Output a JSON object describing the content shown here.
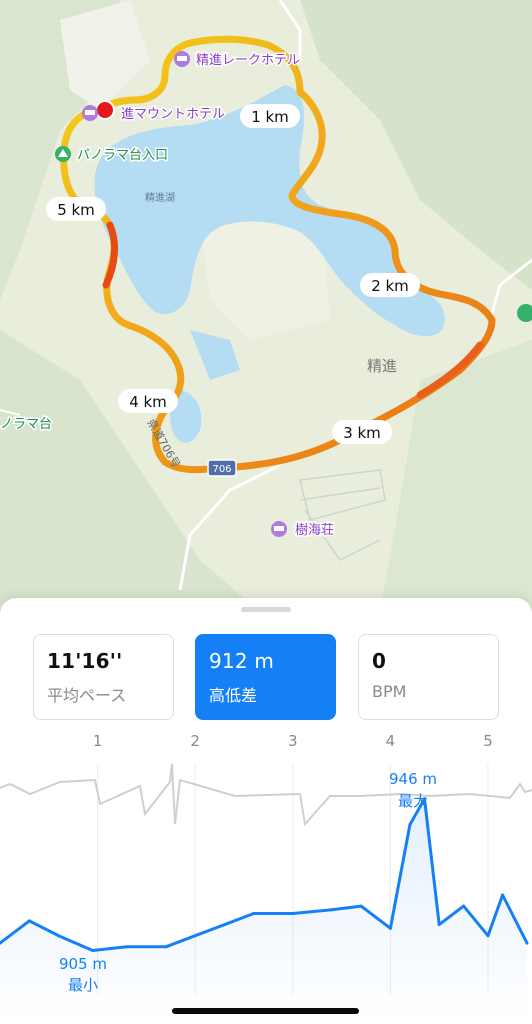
{
  "map": {
    "lake_name": "精進湖",
    "area_name": "精進",
    "road_name": "県道706号",
    "route_badge": "706",
    "pois": [
      {
        "label": "精進レークホテル",
        "icon": "hotel-icon"
      },
      {
        "label": "進マウントホテル",
        "icon": "hotel-icon"
      },
      {
        "label": "パノラマ台入口",
        "icon": "trailhead-icon"
      },
      {
        "label": "ノラマ台",
        "icon": "peak-icon"
      },
      {
        "label": "樹海荘",
        "icon": "hotel-icon"
      }
    ],
    "km_markers": [
      "1 km",
      "2 km",
      "3 km",
      "4 km",
      "5 km"
    ],
    "colors": {
      "land": "#e9efdc",
      "lake": "#b4dcf3",
      "route_slow": "#f3c512",
      "route_fast": "#e64b14",
      "start_marker": "#e5161c"
    }
  },
  "stats": {
    "pace": {
      "value": "11'16''",
      "label": "平均ペース"
    },
    "elevation": {
      "value": "912 m",
      "label": "高低差"
    },
    "heart_rate": {
      "value": "0",
      "label": "BPM"
    }
  },
  "chart_data": {
    "type": "line",
    "x_ticks": [
      "1",
      "2",
      "3",
      "4",
      "5"
    ],
    "x_unit": "km",
    "series": [
      {
        "name": "高低差",
        "color": "#1580f5",
        "x": [
          0,
          0.3,
          0.6,
          0.95,
          1.3,
          1.7,
          2.0,
          2.3,
          2.6,
          3.0,
          3.4,
          3.7,
          4.0,
          4.2,
          4.35,
          4.5,
          4.75,
          5.0,
          5.15,
          5.4
        ],
        "values": [
          907,
          913,
          909,
          905,
          906,
          906,
          909,
          912,
          915,
          915,
          916,
          917,
          911,
          939,
          946,
          912,
          917,
          909,
          920,
          907
        ]
      }
    ],
    "annotations": [
      {
        "label": "946 m",
        "sub": "最大"
      },
      {
        "label": "905 m",
        "sub": "最小"
      }
    ]
  }
}
